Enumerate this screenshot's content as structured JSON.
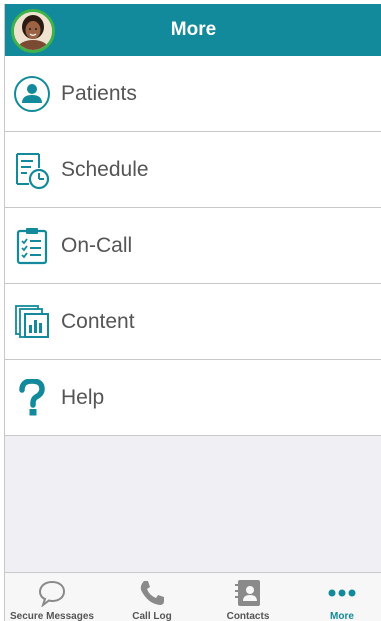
{
  "header": {
    "title": "More",
    "avatar_icon": "user-avatar"
  },
  "menu": {
    "items": [
      {
        "label": "Patients",
        "icon": "patient-icon"
      },
      {
        "label": "Schedule",
        "icon": "schedule-icon"
      },
      {
        "label": "On-Call",
        "icon": "clipboard-icon"
      },
      {
        "label": "Content",
        "icon": "content-icon"
      },
      {
        "label": "Help",
        "icon": "help-icon"
      }
    ]
  },
  "tabbar": {
    "tabs": [
      {
        "label": "Secure Messages",
        "icon": "chat-bubble-icon",
        "active": false
      },
      {
        "label": "Call Log",
        "icon": "phone-icon",
        "active": false
      },
      {
        "label": "Contacts",
        "icon": "contacts-icon",
        "active": false
      },
      {
        "label": "More",
        "icon": "more-dots-icon",
        "active": true
      }
    ]
  },
  "colors": {
    "accent": "#128a9b",
    "avatar_ring": "#3fb24a",
    "background": "#efeff4"
  }
}
